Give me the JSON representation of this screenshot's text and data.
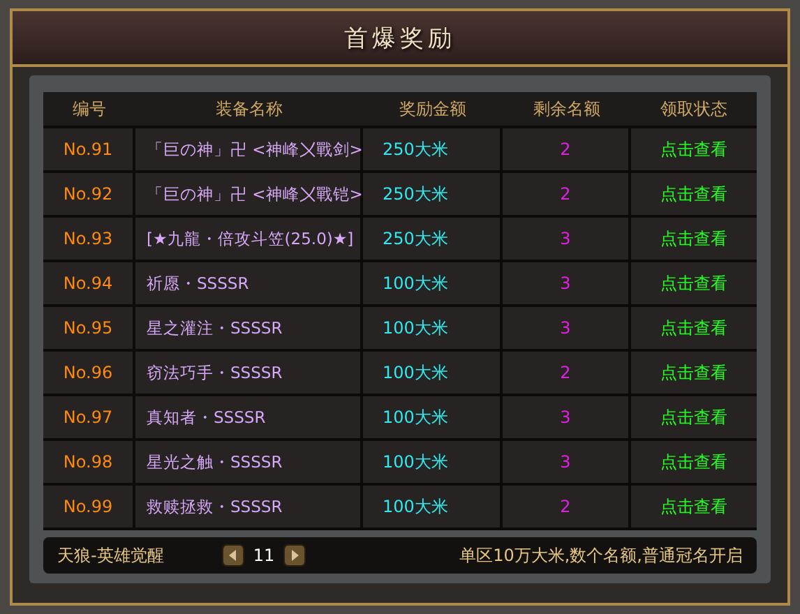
{
  "window": {
    "title": "首爆奖励"
  },
  "table": {
    "columns": [
      "编号",
      "装备名称",
      "奖励金额",
      "剩余名额",
      "领取状态"
    ],
    "rows": [
      {
        "no": "No.91",
        "name": "「巨の神」卍 <神峰〤戰剑>",
        "reward": "250大米",
        "remaining": "2",
        "status": "点击查看"
      },
      {
        "no": "No.92",
        "name": "「巨の神」卍 <神峰〤戰铠>",
        "reward": "250大米",
        "remaining": "2",
        "status": "点击查看"
      },
      {
        "no": "No.93",
        "name": "[★九龍・倍攻斗笠(25.0)★]",
        "reward": "250大米",
        "remaining": "3",
        "status": "点击查看"
      },
      {
        "no": "No.94",
        "name": "祈愿・SSSSR",
        "reward": "100大米",
        "remaining": "3",
        "status": "点击查看"
      },
      {
        "no": "No.95",
        "name": "星之灌注・SSSSR",
        "reward": "100大米",
        "remaining": "3",
        "status": "点击查看"
      },
      {
        "no": "No.96",
        "name": "窃法巧手・SSSSR",
        "reward": "100大米",
        "remaining": "2",
        "status": "点击查看"
      },
      {
        "no": "No.97",
        "name": "真知者・SSSSR",
        "reward": "100大米",
        "remaining": "3",
        "status": "点击查看"
      },
      {
        "no": "No.98",
        "name": "星光之触・SSSSR",
        "reward": "100大米",
        "remaining": "3",
        "status": "点击查看"
      },
      {
        "no": "No.99",
        "name": "救赎拯救・SSSSR",
        "reward": "100大米",
        "remaining": "2",
        "status": "点击查看"
      }
    ]
  },
  "footer": {
    "server": "天狼-英雄觉醒",
    "page": "11",
    "notice": "单区10万大米,数个名额,普通冠名开启"
  }
}
